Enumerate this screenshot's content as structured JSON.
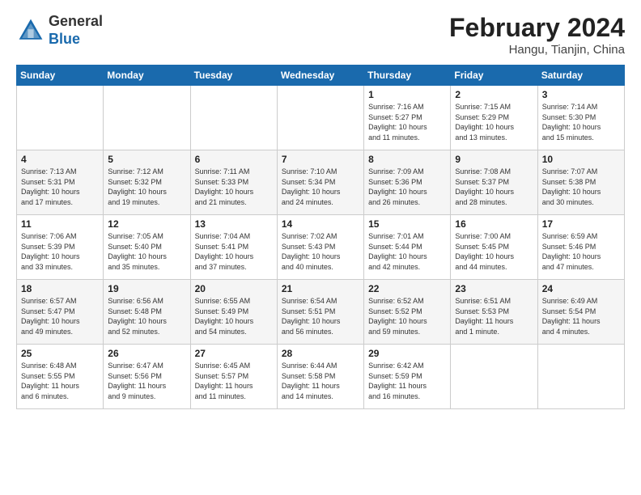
{
  "header": {
    "logo_general": "General",
    "logo_blue": "Blue",
    "month_title": "February 2024",
    "location": "Hangu, Tianjin, China"
  },
  "weekdays": [
    "Sunday",
    "Monday",
    "Tuesday",
    "Wednesday",
    "Thursday",
    "Friday",
    "Saturday"
  ],
  "weeks": [
    [
      {
        "day": "",
        "info": ""
      },
      {
        "day": "",
        "info": ""
      },
      {
        "day": "",
        "info": ""
      },
      {
        "day": "",
        "info": ""
      },
      {
        "day": "1",
        "info": "Sunrise: 7:16 AM\nSunset: 5:27 PM\nDaylight: 10 hours\nand 11 minutes."
      },
      {
        "day": "2",
        "info": "Sunrise: 7:15 AM\nSunset: 5:29 PM\nDaylight: 10 hours\nand 13 minutes."
      },
      {
        "day": "3",
        "info": "Sunrise: 7:14 AM\nSunset: 5:30 PM\nDaylight: 10 hours\nand 15 minutes."
      }
    ],
    [
      {
        "day": "4",
        "info": "Sunrise: 7:13 AM\nSunset: 5:31 PM\nDaylight: 10 hours\nand 17 minutes."
      },
      {
        "day": "5",
        "info": "Sunrise: 7:12 AM\nSunset: 5:32 PM\nDaylight: 10 hours\nand 19 minutes."
      },
      {
        "day": "6",
        "info": "Sunrise: 7:11 AM\nSunset: 5:33 PM\nDaylight: 10 hours\nand 21 minutes."
      },
      {
        "day": "7",
        "info": "Sunrise: 7:10 AM\nSunset: 5:34 PM\nDaylight: 10 hours\nand 24 minutes."
      },
      {
        "day": "8",
        "info": "Sunrise: 7:09 AM\nSunset: 5:36 PM\nDaylight: 10 hours\nand 26 minutes."
      },
      {
        "day": "9",
        "info": "Sunrise: 7:08 AM\nSunset: 5:37 PM\nDaylight: 10 hours\nand 28 minutes."
      },
      {
        "day": "10",
        "info": "Sunrise: 7:07 AM\nSunset: 5:38 PM\nDaylight: 10 hours\nand 30 minutes."
      }
    ],
    [
      {
        "day": "11",
        "info": "Sunrise: 7:06 AM\nSunset: 5:39 PM\nDaylight: 10 hours\nand 33 minutes."
      },
      {
        "day": "12",
        "info": "Sunrise: 7:05 AM\nSunset: 5:40 PM\nDaylight: 10 hours\nand 35 minutes."
      },
      {
        "day": "13",
        "info": "Sunrise: 7:04 AM\nSunset: 5:41 PM\nDaylight: 10 hours\nand 37 minutes."
      },
      {
        "day": "14",
        "info": "Sunrise: 7:02 AM\nSunset: 5:43 PM\nDaylight: 10 hours\nand 40 minutes."
      },
      {
        "day": "15",
        "info": "Sunrise: 7:01 AM\nSunset: 5:44 PM\nDaylight: 10 hours\nand 42 minutes."
      },
      {
        "day": "16",
        "info": "Sunrise: 7:00 AM\nSunset: 5:45 PM\nDaylight: 10 hours\nand 44 minutes."
      },
      {
        "day": "17",
        "info": "Sunrise: 6:59 AM\nSunset: 5:46 PM\nDaylight: 10 hours\nand 47 minutes."
      }
    ],
    [
      {
        "day": "18",
        "info": "Sunrise: 6:57 AM\nSunset: 5:47 PM\nDaylight: 10 hours\nand 49 minutes."
      },
      {
        "day": "19",
        "info": "Sunrise: 6:56 AM\nSunset: 5:48 PM\nDaylight: 10 hours\nand 52 minutes."
      },
      {
        "day": "20",
        "info": "Sunrise: 6:55 AM\nSunset: 5:49 PM\nDaylight: 10 hours\nand 54 minutes."
      },
      {
        "day": "21",
        "info": "Sunrise: 6:54 AM\nSunset: 5:51 PM\nDaylight: 10 hours\nand 56 minutes."
      },
      {
        "day": "22",
        "info": "Sunrise: 6:52 AM\nSunset: 5:52 PM\nDaylight: 10 hours\nand 59 minutes."
      },
      {
        "day": "23",
        "info": "Sunrise: 6:51 AM\nSunset: 5:53 PM\nDaylight: 11 hours\nand 1 minute."
      },
      {
        "day": "24",
        "info": "Sunrise: 6:49 AM\nSunset: 5:54 PM\nDaylight: 11 hours\nand 4 minutes."
      }
    ],
    [
      {
        "day": "25",
        "info": "Sunrise: 6:48 AM\nSunset: 5:55 PM\nDaylight: 11 hours\nand 6 minutes."
      },
      {
        "day": "26",
        "info": "Sunrise: 6:47 AM\nSunset: 5:56 PM\nDaylight: 11 hours\nand 9 minutes."
      },
      {
        "day": "27",
        "info": "Sunrise: 6:45 AM\nSunset: 5:57 PM\nDaylight: 11 hours\nand 11 minutes."
      },
      {
        "day": "28",
        "info": "Sunrise: 6:44 AM\nSunset: 5:58 PM\nDaylight: 11 hours\nand 14 minutes."
      },
      {
        "day": "29",
        "info": "Sunrise: 6:42 AM\nSunset: 5:59 PM\nDaylight: 11 hours\nand 16 minutes."
      },
      {
        "day": "",
        "info": ""
      },
      {
        "day": "",
        "info": ""
      }
    ]
  ]
}
